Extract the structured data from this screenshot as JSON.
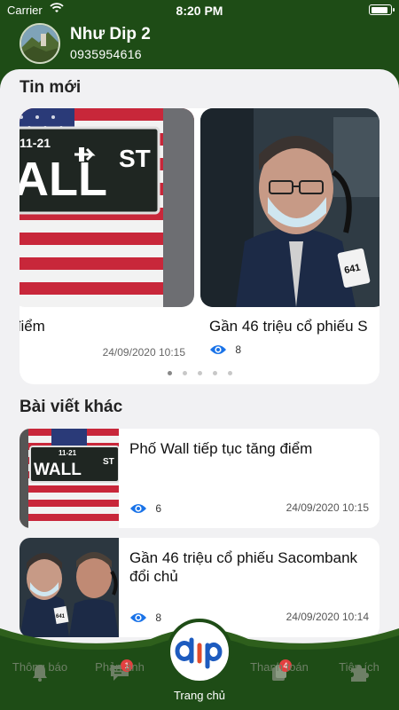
{
  "status_bar": {
    "carrier": "Carrier",
    "time": "8:20 PM",
    "battery_level": 0.9
  },
  "profile": {
    "name": "Như Dip 2",
    "phone": "0935954616"
  },
  "latest": {
    "title": "Tin mới",
    "cards": [
      {
        "title": "điểm",
        "date": "24/09/2020 10:15"
      },
      {
        "title": "Gần 46 triệu cổ phiếu S",
        "views": "8"
      }
    ],
    "pager": {
      "count": 5,
      "active": 0
    }
  },
  "other": {
    "title": "Bài viết khác",
    "items": [
      {
        "title": "Phố Wall tiếp tục tăng điểm",
        "views": "6",
        "date": "24/09/2020 10:15"
      },
      {
        "title": "Gần 46 triệu cổ phiếu Sacombank đổi chủ",
        "views": "8",
        "date": "24/09/2020 10:14"
      }
    ]
  },
  "nav": {
    "items": [
      {
        "label": "Thông báo",
        "icon": "bell-icon"
      },
      {
        "label": "Phản ánh",
        "icon": "chat-icon",
        "badge": "1"
      },
      {
        "label": "Trang chủ",
        "icon": "home-logo"
      },
      {
        "label": "Thanh toán",
        "icon": "wallet-icon",
        "badge": "4"
      },
      {
        "label": "Tiện ích",
        "icon": "puzzle-icon"
      }
    ],
    "logo_text": "dip"
  },
  "colors": {
    "header_green": "#1e4c16",
    "accent_blue": "#1a73e8",
    "logo_red": "#e24b2c",
    "logo_blue": "#1d5bbf"
  }
}
